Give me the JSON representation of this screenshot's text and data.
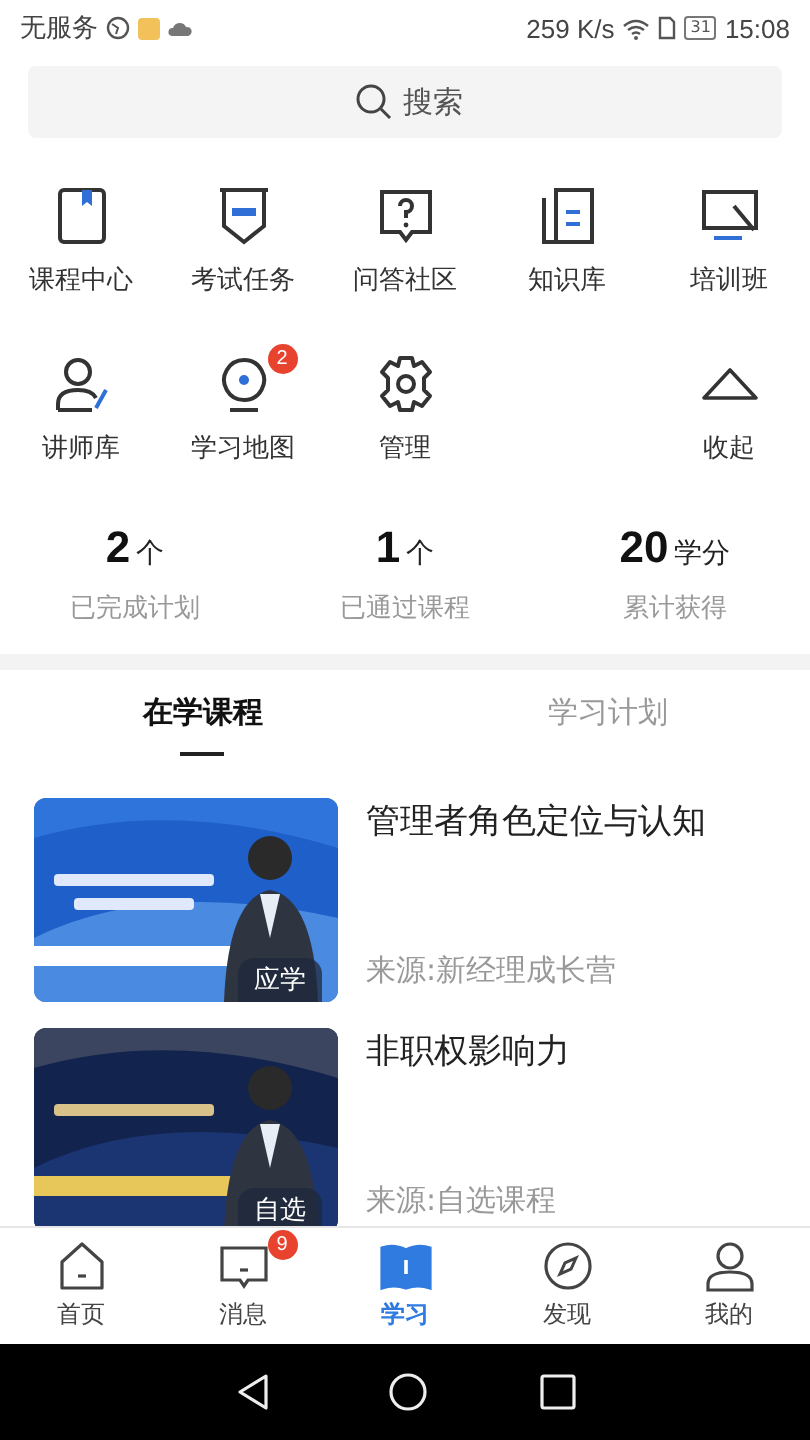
{
  "status_bar": {
    "carrier": "无服务",
    "speed": "259 K/s",
    "battery": "31",
    "time": "15:08"
  },
  "search": {
    "placeholder": "搜索"
  },
  "shortcuts": [
    {
      "label": "课程中心"
    },
    {
      "label": "考试任务"
    },
    {
      "label": "问答社区"
    },
    {
      "label": "知识库"
    },
    {
      "label": "培训班"
    },
    {
      "label": "讲师库"
    },
    {
      "label": "学习地图",
      "badge": "2"
    },
    {
      "label": "管理"
    },
    {
      "label": "收起"
    }
  ],
  "stats": [
    {
      "value": "2",
      "unit": "个",
      "label": "已完成计划"
    },
    {
      "value": "1",
      "unit": "个",
      "label": "已通过课程"
    },
    {
      "value": "20",
      "unit": "学分",
      "label": "累计获得"
    }
  ],
  "tabs": [
    {
      "label": "在学课程",
      "selected": true
    },
    {
      "label": "学习计划",
      "selected": false
    }
  ],
  "courses": [
    {
      "title": "管理者角色定位与认知",
      "source": "来源:新经理成长营",
      "tag": "应学"
    },
    {
      "title": "非职权影响力",
      "source": "来源:自选课程",
      "tag": "自选"
    }
  ],
  "bottom_nav": [
    {
      "label": "首页",
      "selected": false
    },
    {
      "label": "消息",
      "selected": false,
      "badge": "9"
    },
    {
      "label": "学习",
      "selected": true
    },
    {
      "label": "发现",
      "selected": false
    },
    {
      "label": "我的",
      "selected": false
    }
  ]
}
